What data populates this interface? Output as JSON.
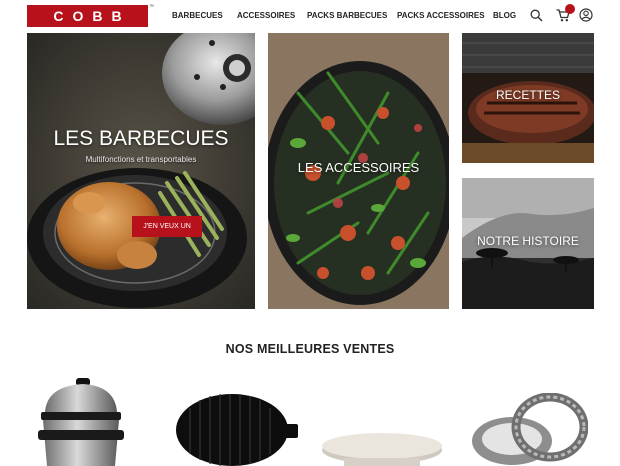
{
  "brand": {
    "logo_text": "COBB",
    "trademark": "™"
  },
  "nav": {
    "items": [
      "BARBECUES",
      "ACCESSOIRES",
      "PACKS BARBECUES",
      "PACKS ACCESSOIRES",
      "BLOG"
    ]
  },
  "header_icons": [
    "search-icon",
    "cart-icon",
    "user-icon"
  ],
  "tiles": {
    "barbecues": {
      "title": "LES BARBECUES",
      "subtitle": "Multifonctions et transportables",
      "cta": "J'EN VEUX UN"
    },
    "accessoires": {
      "title": "LES ACCESSOIRES"
    },
    "recettes": {
      "title": "RECETTES"
    },
    "histoire": {
      "title": "NOTRE HISTOIRE"
    }
  },
  "bestsellers": {
    "title": "NOS MEILLEURES VENTES",
    "products": [
      "cobb-grill",
      "griddle-plate",
      "cutting-board",
      "fire-rings"
    ]
  },
  "colors": {
    "brand_red": "#b7121c",
    "text": "#222222"
  }
}
